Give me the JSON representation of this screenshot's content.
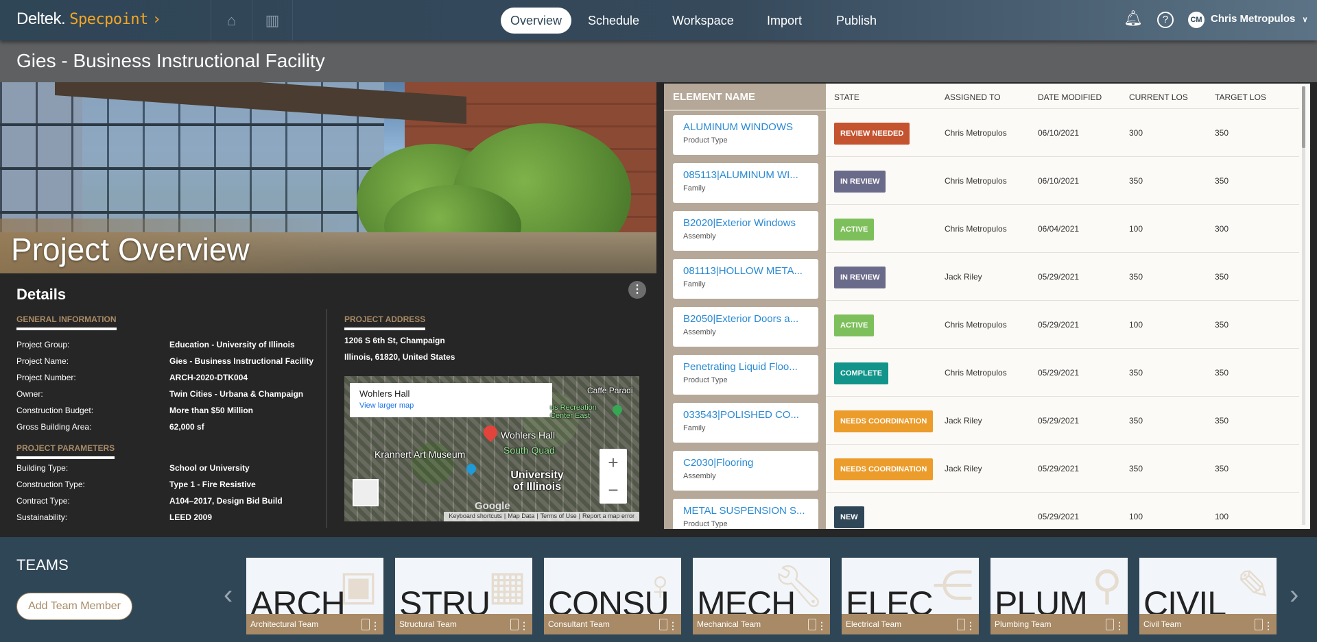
{
  "header": {
    "brand": "Deltek.",
    "product": "Specpoint",
    "product_chevron": "›",
    "nav": [
      {
        "label": "Overview",
        "active": true
      },
      {
        "label": "Schedule"
      },
      {
        "label": "Workspace"
      },
      {
        "label": "Import"
      },
      {
        "label": "Publish"
      }
    ],
    "user": {
      "initials": "CM",
      "name": "Chris Metropulos"
    }
  },
  "page_title": "Gies - Business Instructional Facility",
  "hero": {
    "title": "Project Overview"
  },
  "details": {
    "title": "Details",
    "general": {
      "heading": "GENERAL INFORMATION",
      "rows": [
        {
          "label": "Project Group:",
          "value": "Education - University of Illinois"
        },
        {
          "label": "Project Name:",
          "value": "Gies - Business Instructional Facility"
        },
        {
          "label": "Project Number:",
          "value": "ARCH-2020-DTK004"
        },
        {
          "label": "Owner:",
          "value": "Twin Cities - Urbana & Champaign"
        },
        {
          "label": "Construction Budget:",
          "value": "More than $50 Million"
        },
        {
          "label": "Gross Building Area:",
          "value": "62,000 sf"
        }
      ]
    },
    "parameters": {
      "heading": "PROJECT PARAMETERS",
      "rows": [
        {
          "label": "Building Type:",
          "value": "School or University"
        },
        {
          "label": "Construction Type:",
          "value": "Type 1 - Fire Resistive"
        },
        {
          "label": "Contract Type:",
          "value": "A104–2017, Design Bid Build"
        },
        {
          "label": "Sustainability:",
          "value": "LEED 2009"
        }
      ]
    },
    "address": {
      "heading": "PROJECT ADDRESS",
      "line1": "1206 S 6th St, Champaign",
      "line2": "Illinois, 61820, United States"
    },
    "map": {
      "place": "Wohlers Hall",
      "link": "View larger map",
      "labels": [
        "Wohlers Hall",
        "South Quad",
        "Krannert Art Museum",
        "University of Illinois",
        "Caffe Paradi",
        "us Recreation Center East"
      ],
      "logo": "Google",
      "footer": [
        "Keyboard shortcuts",
        "Map Data",
        "Terms of Use",
        "Report a map error"
      ]
    }
  },
  "table": {
    "headers": [
      "ELEMENT NAME",
      "STATE",
      "ASSIGNED TO",
      "DATE MODIFIED",
      "CURRENT LOS",
      "TARGET LOS"
    ],
    "rows": [
      {
        "name": "ALUMINUM WINDOWS",
        "type": "Product Type",
        "state": "REVIEW NEEDED",
        "color": "#c4532f",
        "assigned": "Chris Metropulos",
        "date": "06/10/2021",
        "current": "300",
        "target": "350"
      },
      {
        "name": "085113|ALUMINUM WI...",
        "type": "Family",
        "state": "IN REVIEW",
        "color": "#6a6a8a",
        "assigned": "Chris Metropulos",
        "date": "06/10/2021",
        "current": "350",
        "target": "350"
      },
      {
        "name": "B2020|Exterior Windows",
        "type": "Assembly",
        "state": "ACTIVE",
        "color": "#7dc05b",
        "assigned": "Chris Metropulos",
        "date": "06/04/2021",
        "current": "100",
        "target": "300"
      },
      {
        "name": "081113|HOLLOW META...",
        "type": "Family",
        "state": "IN REVIEW",
        "color": "#6a6a8a",
        "assigned": "Jack Riley",
        "date": "05/29/2021",
        "current": "350",
        "target": "350"
      },
      {
        "name": "B2050|Exterior Doors a...",
        "type": "Assembly",
        "state": "ACTIVE",
        "color": "#7dc05b",
        "assigned": "Chris Metropulos",
        "date": "05/29/2021",
        "current": "100",
        "target": "350"
      },
      {
        "name": "Penetrating Liquid Floo...",
        "type": "Product Type",
        "state": "COMPLETE",
        "color": "#12948a",
        "assigned": "Chris Metropulos",
        "date": "05/29/2021",
        "current": "350",
        "target": "350"
      },
      {
        "name": "033543|POLISHED CO...",
        "type": "Family",
        "state": "NEEDS COORDINATION",
        "color": "#eb9c2b",
        "assigned": "Jack Riley",
        "date": "05/29/2021",
        "current": "350",
        "target": "350"
      },
      {
        "name": "C2030|Flooring",
        "type": "Assembly",
        "state": "NEEDS COORDINATION",
        "color": "#eb9c2b",
        "assigned": "Jack Riley",
        "date": "05/29/2021",
        "current": "350",
        "target": "350"
      },
      {
        "name": "METAL SUSPENSION S...",
        "type": "Product Type",
        "state": "NEW",
        "color": "#2f4657",
        "assigned": "",
        "date": "05/29/2021",
        "current": "100",
        "target": "100"
      }
    ]
  },
  "teams": {
    "title": "TEAMS",
    "add_label": "Add Team Member",
    "items": [
      {
        "abbr": "ARCH",
        "name": "Architectural Team",
        "icon": "blueprint-icon"
      },
      {
        "abbr": "STRU",
        "name": "Structural Team",
        "icon": "beams-icon"
      },
      {
        "abbr": "CONSU",
        "name": "Consultant Team",
        "icon": "person-icon"
      },
      {
        "abbr": "MECH",
        "name": "Mechanical Team",
        "icon": "wrench-icon"
      },
      {
        "abbr": "ELEC",
        "name": "Electrical Team",
        "icon": "circuit-icon"
      },
      {
        "abbr": "PLUM",
        "name": "Plumbing Team",
        "icon": "faucet-icon"
      },
      {
        "abbr": "CIVIL",
        "name": "Civil Team",
        "icon": "ruler-pencil-icon"
      }
    ]
  }
}
